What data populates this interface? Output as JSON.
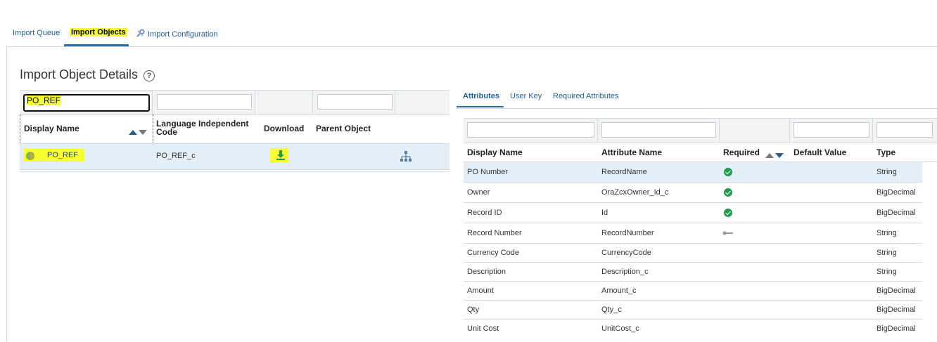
{
  "top_tabs": {
    "import_queue": "Import Queue",
    "import_objects": "Import Objects",
    "import_configuration": "Import Configuration"
  },
  "section": {
    "title": "Import Object Details",
    "help": "?"
  },
  "left_table": {
    "filter_value": "PO_REF",
    "headers": {
      "display_name": "Display Name",
      "language_independent_code_1": "Language Independent",
      "language_independent_code_2": "Code",
      "download": "Download",
      "parent_object": "Parent Object"
    },
    "rows": [
      {
        "display_name": "PO_REF",
        "code": "PO_REF_c"
      }
    ]
  },
  "right_tabs": {
    "attributes": "Attributes",
    "user_key": "User Key",
    "required_attributes": "Required Attributes"
  },
  "attributes_table": {
    "headers": {
      "display_name": "Display Name",
      "attribute_name": "Attribute Name",
      "required": "Required",
      "default_value": "Default Value",
      "type": "Type"
    },
    "rows": [
      {
        "display_name": "PO Number",
        "attribute_name": "RecordName",
        "required": "check",
        "default_value": "",
        "type": "String"
      },
      {
        "display_name": "Owner",
        "attribute_name": "OraZcxOwner_Id_c",
        "required": "check",
        "default_value": "",
        "type": "BigDecimal"
      },
      {
        "display_name": "Record ID",
        "attribute_name": "Id",
        "required": "check",
        "default_value": "",
        "type": "BigDecimal"
      },
      {
        "display_name": "Record Number",
        "attribute_name": "RecordNumber",
        "required": "key",
        "default_value": "",
        "type": "String"
      },
      {
        "display_name": "Currency Code",
        "attribute_name": "CurrencyCode",
        "required": "",
        "default_value": "",
        "type": "String"
      },
      {
        "display_name": "Description",
        "attribute_name": "Description_c",
        "required": "",
        "default_value": "",
        "type": "String"
      },
      {
        "display_name": "Amount",
        "attribute_name": "Amount_c",
        "required": "",
        "default_value": "",
        "type": "BigDecimal"
      },
      {
        "display_name": "Qty",
        "attribute_name": "Qty_c",
        "required": "",
        "default_value": "",
        "type": "BigDecimal"
      },
      {
        "display_name": "Unit Cost",
        "attribute_name": "UnitCost_c",
        "required": "",
        "default_value": "",
        "type": "BigDecimal"
      }
    ]
  },
  "colors": {
    "accent": "#2a6ea6",
    "highlight": "#f7ff2e",
    "selected_row": "#e4eef7",
    "check": "#1f9b4c"
  }
}
